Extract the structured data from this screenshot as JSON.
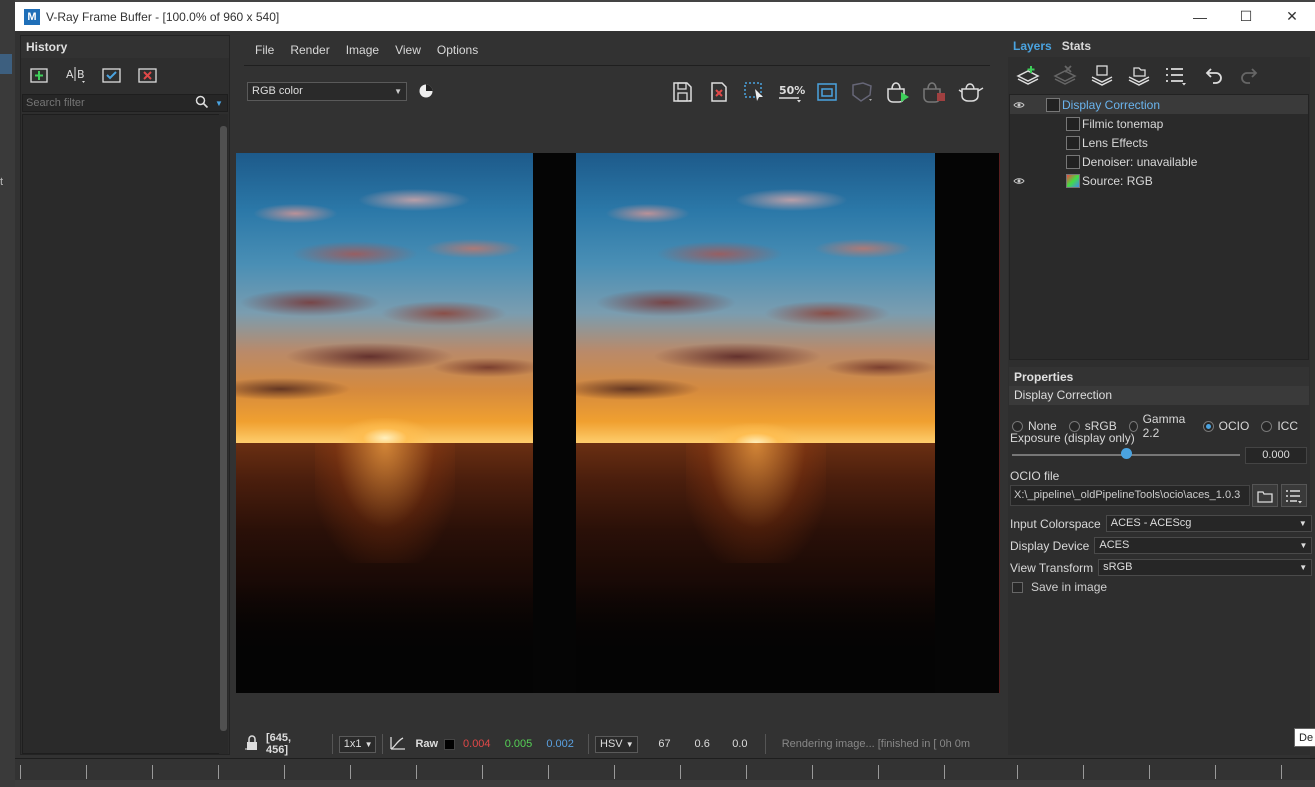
{
  "window": {
    "logo": "M",
    "title": "V-Ray Frame Buffer - [100.0% of 960 x 540]",
    "controls": [
      "minimize-icon",
      "maximize-icon",
      "close-icon"
    ]
  },
  "background": {
    "partial_text": "t"
  },
  "history": {
    "title": "History",
    "search_placeholder": "Search filter",
    "tools": [
      "save-to-history-icon",
      "ab-compare-icon",
      "load-check-icon",
      "remove-icon"
    ]
  },
  "menu": [
    "File",
    "Render",
    "Image",
    "View",
    "Options"
  ],
  "channel": {
    "selected": "RGB color"
  },
  "image_toolbar": {
    "zoom_icon_text": "50%",
    "icons": [
      "save-image-icon",
      "clear-image-icon",
      "region-select-icon",
      "zoom-icon",
      "frame-icon",
      "lock-icon",
      "render-start-icon",
      "render-stop-icon",
      "teapot-icon"
    ]
  },
  "statusbar": {
    "coords": "[645, 456]",
    "sampling": "1x1",
    "raw_label": "Raw",
    "r": "0.004",
    "g": "0.005",
    "b": "0.002",
    "color_mode": "HSV",
    "h": "67",
    "s": "0.6",
    "v": "0.0",
    "message": "Rendering image... [finished in [ 0h  0m"
  },
  "right_panel": {
    "tabs": [
      "Layers",
      "Stats"
    ],
    "layers": [
      {
        "label": "Display Correction",
        "eye": true,
        "indent": 0,
        "selected": true
      },
      {
        "label": "Filmic tonemap",
        "eye": false,
        "indent": 1
      },
      {
        "label": "Lens Effects",
        "eye": false,
        "indent": 1
      },
      {
        "label": "Denoiser: unavailable",
        "eye": false,
        "indent": 1
      },
      {
        "label": "Source: RGB",
        "eye": true,
        "indent": 1
      }
    ],
    "properties": {
      "header": "Properties",
      "section": "Display Correction",
      "modes": [
        {
          "label": "None",
          "selected": false
        },
        {
          "label": "sRGB",
          "selected": false
        },
        {
          "label": "Gamma 2.2",
          "selected": false
        },
        {
          "label": "OCIO",
          "selected": true
        },
        {
          "label": "ICC",
          "selected": false
        }
      ],
      "exposure_label": "Exposure (display only)",
      "exposure_value": "0.000",
      "exposure_level": 0.5,
      "ocio_label": "OCIO file",
      "ocio_path": "X:\\_pipeline\\_oldPipelineTools\\ocio\\aces_1.0.3",
      "input_colorspace_label": "Input Colorspace",
      "input_colorspace": "ACES - ACEScg",
      "display_device_label": "Display Device",
      "display_device": "ACES",
      "view_transform_label": "View Transform",
      "view_transform": "sRGB",
      "save_in_image_label": "Save in image",
      "save_in_image": false
    }
  },
  "tooltip": "De"
}
